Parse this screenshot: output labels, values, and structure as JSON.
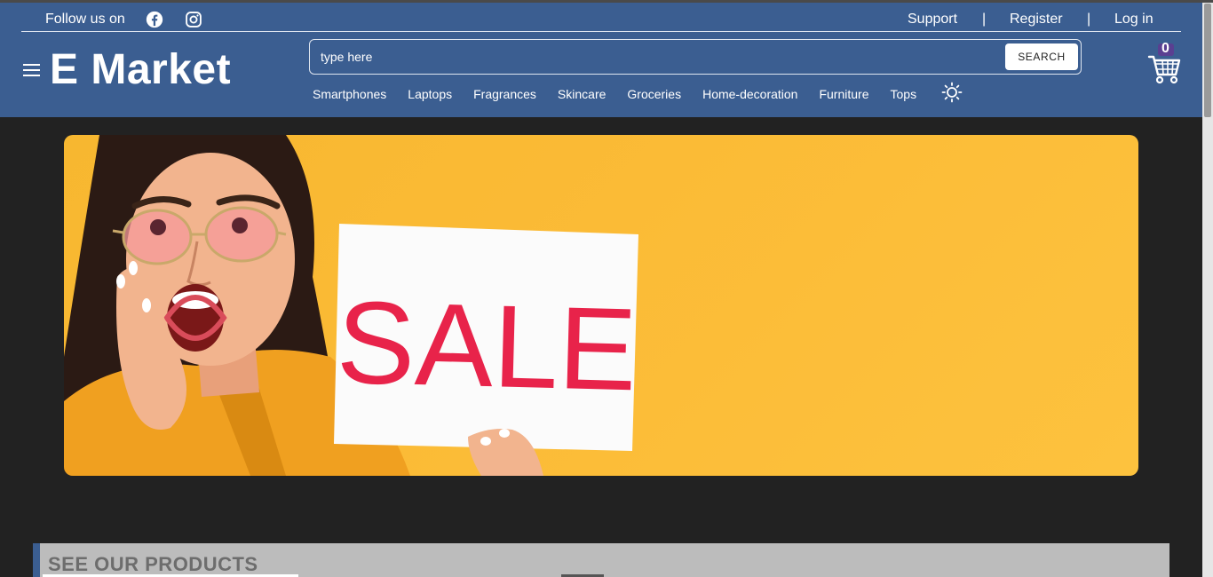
{
  "header": {
    "follow_text": "Follow us on",
    "social": [
      {
        "icon": "facebook-icon"
      },
      {
        "icon": "instagram-icon"
      }
    ],
    "links": {
      "support": "Support",
      "register": "Register",
      "login": "Log in",
      "separator": "|"
    },
    "logo": "E Market",
    "search": {
      "placeholder": "type here",
      "button_label": "SEARCH"
    },
    "categories": [
      "Smartphones",
      "Laptops",
      "Fragrances",
      "Skincare",
      "Groceries",
      "Home-decoration",
      "Furniture",
      "Tops"
    ],
    "cart_count": "0",
    "colors": {
      "header_bg": "#3b5e91",
      "page_bg": "#222222",
      "banner_bg": "#fbbb36",
      "sale_text": "#e8234a"
    }
  },
  "banner": {
    "sign_text": "SALE"
  },
  "section": {
    "title": "SEE OUR PRODUCTS"
  }
}
